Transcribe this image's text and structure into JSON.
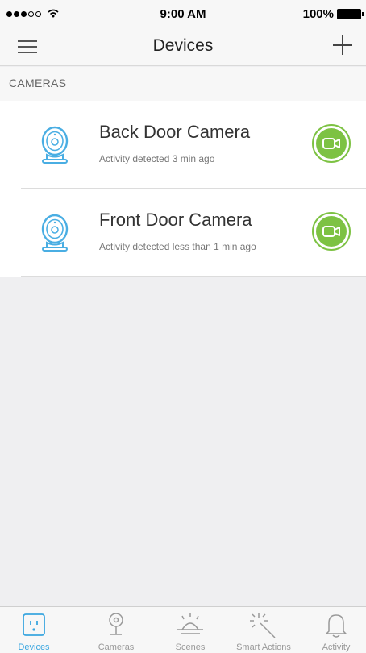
{
  "status_bar": {
    "time": "9:00 AM",
    "battery": "100%"
  },
  "nav": {
    "title": "Devices"
  },
  "section": {
    "title": "CAMERAS"
  },
  "devices": [
    {
      "name": "Back Door Camera",
      "status": "Activity detected 3 min ago"
    },
    {
      "name": "Front Door Camera",
      "status": "Activity detected less than 1 min ago"
    }
  ],
  "tabs": [
    {
      "label": "Devices",
      "icon": "outlet-icon",
      "active": true
    },
    {
      "label": "Cameras",
      "icon": "camera-icon",
      "active": false
    },
    {
      "label": "Scenes",
      "icon": "sunrise-icon",
      "active": false
    },
    {
      "label": "Smart Actions",
      "icon": "magic-wand-icon",
      "active": false
    },
    {
      "label": "Activity",
      "icon": "bell-icon",
      "active": false
    }
  ],
  "colors": {
    "accent": "#3aa6e0",
    "video_green": "#7dc243",
    "icon_blue": "#4aaee3"
  }
}
